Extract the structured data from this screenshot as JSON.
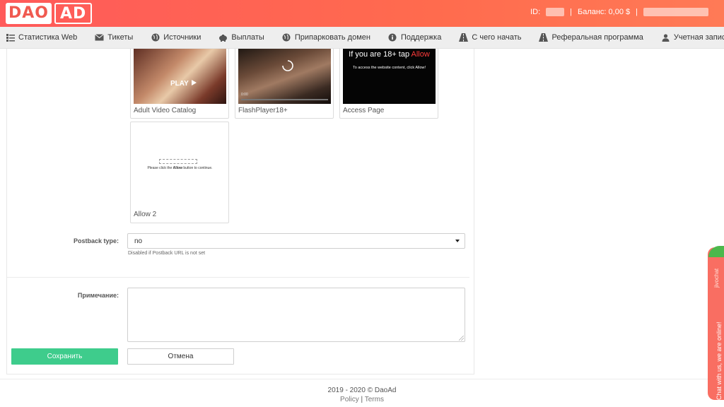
{
  "header": {
    "logo_left": "DAO",
    "logo_right": "AD",
    "id_label": "ID:",
    "balance_label": "Баланс: 0,00 $",
    "separator": "|"
  },
  "nav": {
    "items": [
      {
        "label": "Статистика Web",
        "icon": "stats-icon"
      },
      {
        "label": "Тикеты",
        "icon": "envelope-icon"
      },
      {
        "label": "Источники",
        "icon": "globe-icon"
      },
      {
        "label": "Выплаты",
        "icon": "piggy-bank-icon"
      },
      {
        "label": "Припарковать домен",
        "icon": "globe-icon"
      },
      {
        "label": "Поддержка",
        "icon": "info-icon"
      },
      {
        "label": "С чего начать",
        "icon": "road-icon"
      },
      {
        "label": "Реферальная программа",
        "icon": "road-icon"
      },
      {
        "label": "Учетная запись",
        "icon": "user-icon"
      }
    ]
  },
  "templates": [
    {
      "caption": "Adult Video Catalog",
      "overlay": "PLAY"
    },
    {
      "caption": "FlashPlayer18+",
      "overlay": "0:00"
    },
    {
      "caption": "Access Page",
      "headline_a": "If you are 18+ tap",
      "headline_b": "Allow",
      "subtext": "To access the website content, click Allow!"
    },
    {
      "caption": "Allow 2",
      "subtext_a": "Please click the",
      "subtext_b": "Allow",
      "subtext_c": "button to continue."
    }
  ],
  "form": {
    "postback_label": "Postback type:",
    "postback_value": "no",
    "postback_help": "Disabled if Postback URL is not set",
    "note_label": "Примечание:",
    "note_value": "",
    "save_label": "Сохранить",
    "cancel_label": "Отмена"
  },
  "footer": {
    "copyright": "2019 - 2020 © DaoAd",
    "policy": "Policy",
    "sep": "|",
    "terms": "Terms"
  },
  "chat": {
    "text": "Chat with us, we are online!",
    "brand": "jivochat"
  },
  "colors": {
    "header_gradient_start": "#ff5a5a",
    "header_gradient_end": "#ff7a56",
    "save_button": "#3ecc8c",
    "chat_tab": "#f96e62",
    "chat_leaf": "#4cb84c"
  }
}
